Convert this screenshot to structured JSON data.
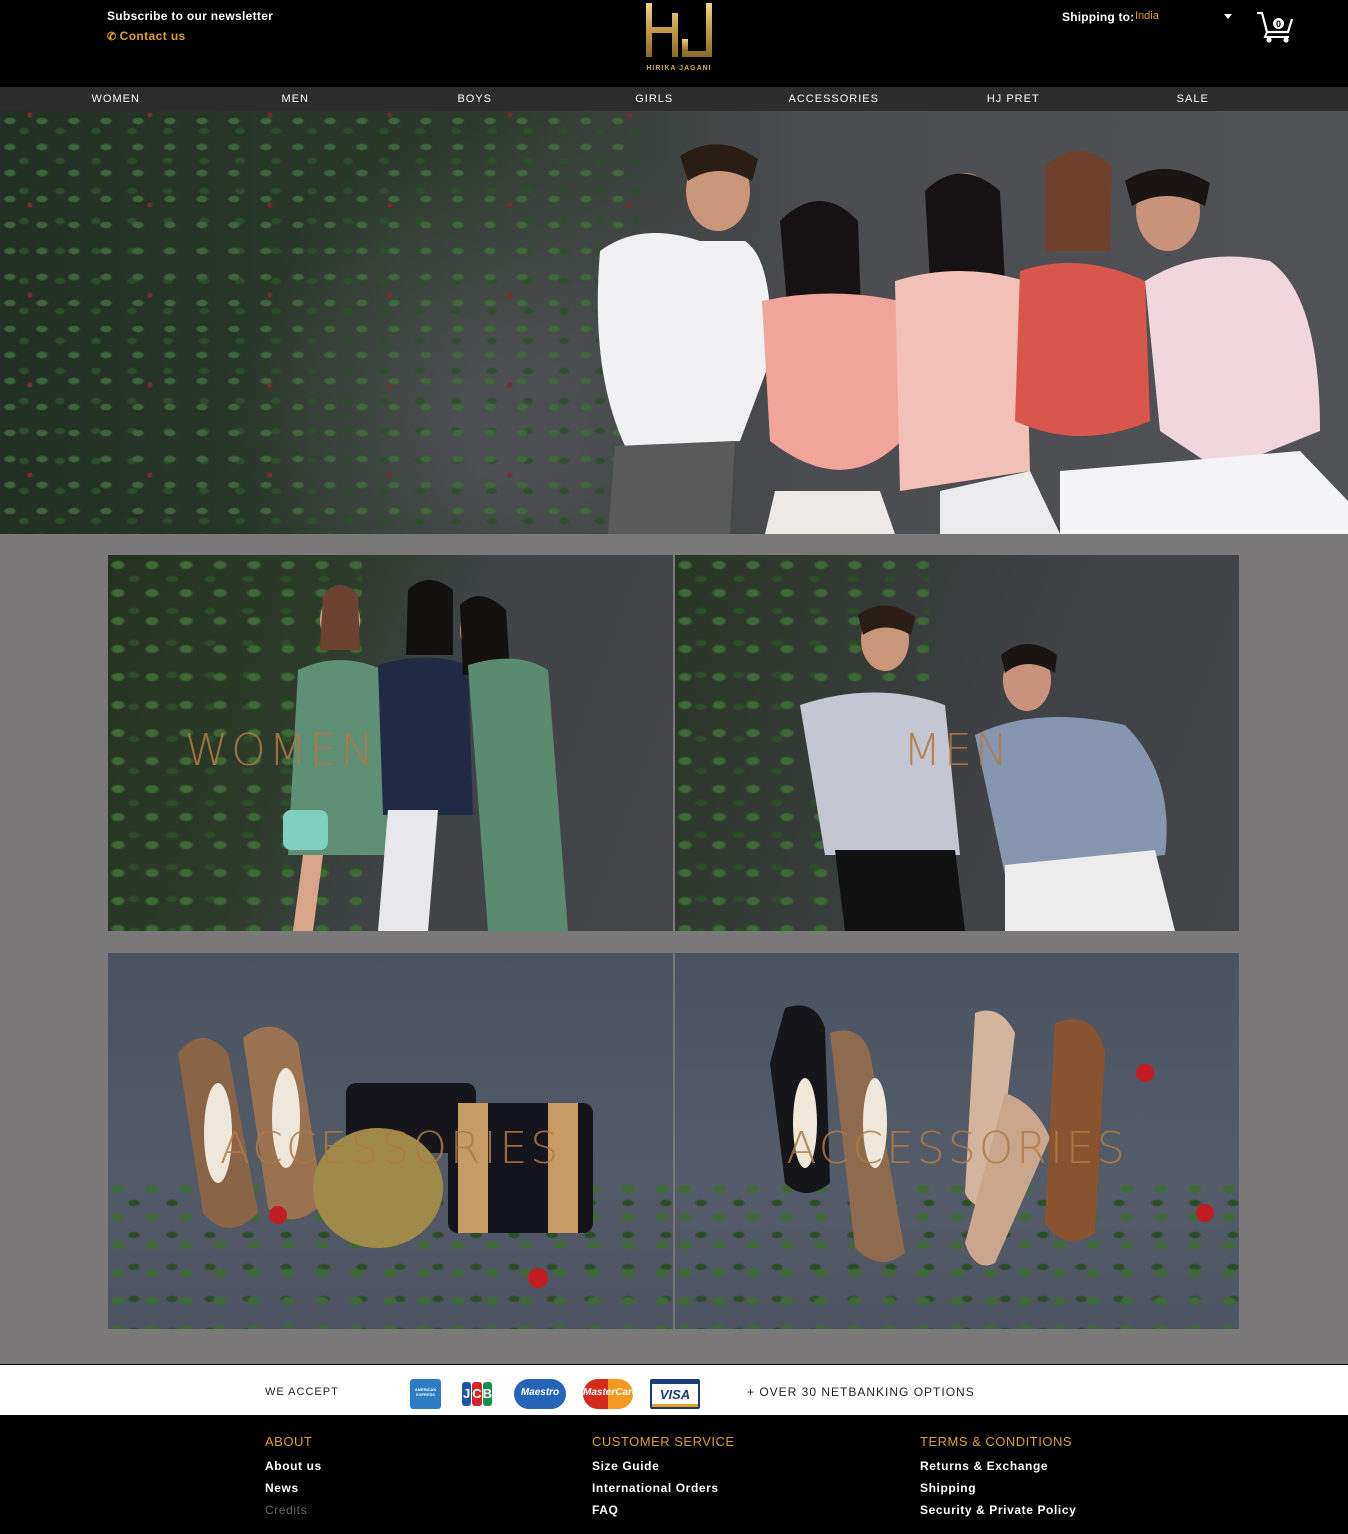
{
  "header": {
    "newsletter_label": "Subscribe to our newsletter",
    "contact_label": "Contact us",
    "logo_text": "HIRIKA JAGANI",
    "shipping_label": "Shipping to:",
    "shipping_value": "India",
    "cart_count": "0"
  },
  "nav": {
    "items": [
      {
        "label": "WOMEN"
      },
      {
        "label": "MEN"
      },
      {
        "label": "BOYS"
      },
      {
        "label": "GIRLS"
      },
      {
        "label": "ACCESSORIES"
      },
      {
        "label": "HJ PRET"
      },
      {
        "label": "SALE"
      }
    ]
  },
  "tiles": {
    "women": "WOMEN",
    "men": "MEN",
    "accessories_1": "ACCESSORIES",
    "accessories_2": "ACCESSORIES"
  },
  "payments": {
    "we_accept": "WE ACCEPT",
    "cards": [
      {
        "name": "American Express",
        "icon": "amex-icon",
        "text": "AMERICAN EXPRESS"
      },
      {
        "name": "JCB",
        "icon": "jcb-icon",
        "text": "JCB"
      },
      {
        "name": "Maestro",
        "icon": "maestro-icon",
        "text": "Maestro"
      },
      {
        "name": "MasterCard",
        "icon": "mastercard-icon",
        "text": "MasterCard"
      },
      {
        "name": "Visa",
        "icon": "visa-icon",
        "text": "VISA"
      }
    ],
    "netbanking": "+ OVER 30 NETBANKING OPTIONS"
  },
  "footer": {
    "about": {
      "heading": "ABOUT",
      "links": [
        "About us",
        "News",
        "Credits"
      ]
    },
    "service": {
      "heading": "CUSTOMER SERVICE",
      "links": [
        "Size Guide",
        "International Orders",
        "FAQ"
      ]
    },
    "terms": {
      "heading": "TERMS & CONDITIONS",
      "links": [
        "Returns & Exchange",
        "Shipping",
        "Security & Private Policy"
      ]
    }
  },
  "colors": {
    "accent": "#e0a126",
    "nav_bg": "#2c2c2c",
    "grid_bg": "#7a7879",
    "tile_label": "#b07a45"
  }
}
